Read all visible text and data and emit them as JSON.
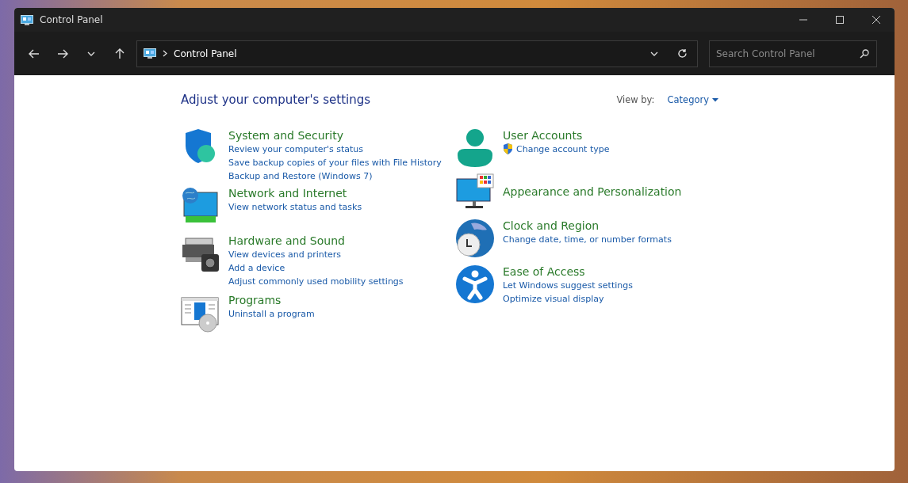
{
  "window": {
    "title": "Control Panel"
  },
  "toolbar": {
    "path": [
      "Control Panel"
    ],
    "search": {
      "placeholder": "Search Control Panel"
    }
  },
  "heading": "Adjust your computer's settings",
  "view_by": {
    "label": "View by:",
    "value": "Category"
  },
  "columns": [
    [
      {
        "title": "System and Security",
        "links": [
          {
            "kind": "plain",
            "text": "Review your computer's status"
          },
          {
            "kind": "plain",
            "text": "Save backup copies of your files with File History"
          },
          {
            "kind": "plain",
            "text": "Backup and Restore (Windows 7)"
          }
        ]
      },
      {
        "title": "Network and Internet",
        "links": [
          {
            "kind": "plain",
            "text": "View network status and tasks"
          }
        ]
      },
      {
        "title": "Hardware and Sound",
        "links": [
          {
            "kind": "plain",
            "text": "View devices and printers"
          },
          {
            "kind": "plain",
            "text": "Add a device"
          },
          {
            "kind": "plain",
            "text": "Adjust commonly used mobility settings"
          }
        ]
      },
      {
        "title": "Programs",
        "links": [
          {
            "kind": "plain",
            "text": "Uninstall a program"
          }
        ]
      }
    ],
    [
      {
        "title": "User Accounts",
        "links": [
          {
            "kind": "admin",
            "text": "Change account type"
          }
        ]
      },
      {
        "title": "Appearance and Personalization"
      },
      {
        "title": "Clock and Region",
        "links": [
          {
            "kind": "plain",
            "text": "Change date, time, or number formats"
          }
        ]
      },
      {
        "title": "Ease of Access",
        "links": [
          {
            "kind": "plain",
            "text": "Let Windows suggest settings"
          },
          {
            "kind": "plain",
            "text": "Optimize visual display"
          }
        ]
      }
    ]
  ]
}
